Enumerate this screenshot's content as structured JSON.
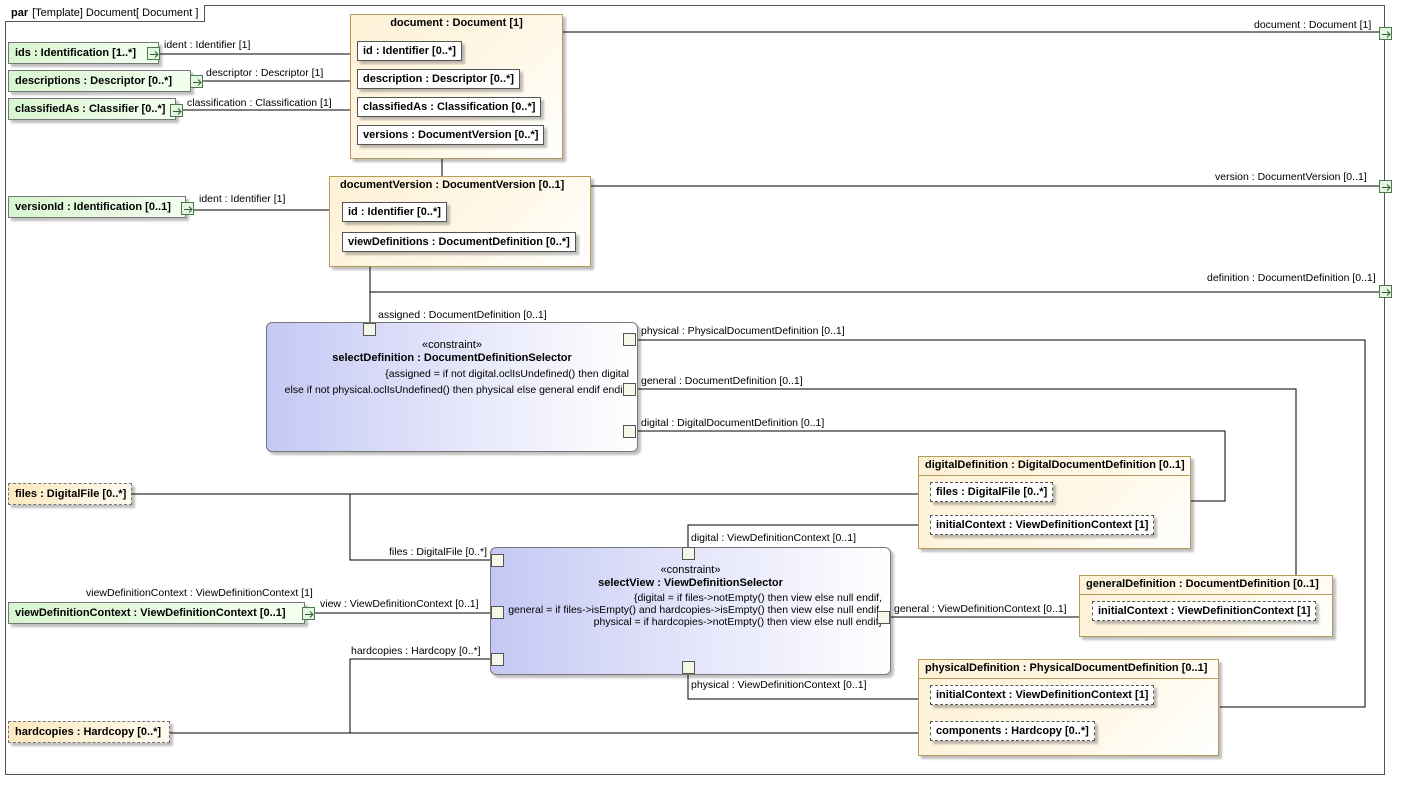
{
  "frame": {
    "kind": "par",
    "title": "[Template] Document[ Document ]"
  },
  "labels": {
    "ident_ids": "ident : Identifier [1]",
    "descriptor": "descriptor : Descriptor [1]",
    "classification": "classification : Classification [1]",
    "ident_version": "ident : Identifier [1]",
    "port_document": "document : Document [1]",
    "port_version": "version : DocumentVersion [0..1]",
    "port_definition": "definition : DocumentDefinition [0..1]",
    "assigned": "assigned : DocumentDefinition [0..1]",
    "physical_sel": "physical : PhysicalDocumentDefinition [0..1]",
    "general_sel": "general : DocumentDefinition [0..1]",
    "digital_sel": "digital : DigitalDocumentDefinition [0..1]",
    "files_port": "files : DigitalFile [0..*]",
    "vdc_ext": "viewDefinitionContext : ViewDefinitionContext [1]",
    "view_port": "view : ViewDefinitionContext [0..1]",
    "hardcopies_port": "hardcopies : Hardcopy [0..*]",
    "digital_view": "digital : ViewDefinitionContext [0..1]",
    "general_view": "general : ViewDefinitionContext [0..1]",
    "physical_view": "physical : ViewDefinitionContext [0..1]"
  },
  "externals": {
    "ids": "ids : Identification [1..*]",
    "descriptions": "descriptions : Descriptor [0..*]",
    "classifiedAs": "classifiedAs : Classifier [0..*]",
    "versionId": "versionId : Identification [0..1]",
    "files": "files : DigitalFile [0..*]",
    "viewDefinitionContext": "viewDefinitionContext : ViewDefinitionContext [0..1]",
    "hardcopies": "hardcopies : Hardcopy [0..*]"
  },
  "document": {
    "title": "document : Document [1]",
    "parts": [
      "id : Identifier [0..*]",
      "description : Descriptor [0..*]",
      "classifiedAs : Classification [0..*]",
      "versions : DocumentVersion [0..*]"
    ]
  },
  "documentVersion": {
    "title": "documentVersion : DocumentVersion [0..1]",
    "parts": [
      "id : Identifier [0..*]",
      "viewDefinitions : DocumentDefinition [0..*]"
    ]
  },
  "selectDefinition": {
    "stereotype": "«constraint»",
    "name": "selectDefinition : DocumentDefinitionSelector",
    "expr1": "{assigned = if not digital.oclIsUndefined() then digital",
    "expr2": "else if not physical.oclIsUndefined() then physical else general endif endif}"
  },
  "selectView": {
    "stereotype": "«constraint»",
    "name": "selectView : ViewDefinitionSelector",
    "expr1": "{digital = if files->notEmpty() then view else null endif,",
    "expr2": "general = if files->isEmpty() and hardcopies->isEmpty() then view else null endif,",
    "expr3": "physical = if hardcopies->notEmpty() then view else null endif}"
  },
  "digitalDefinition": {
    "title": "digitalDefinition : DigitalDocumentDefinition [0..1]",
    "parts": [
      "files : DigitalFile [0..*]",
      "initialContext : ViewDefinitionContext [1]"
    ]
  },
  "generalDefinition": {
    "title": "generalDefinition : DocumentDefinition [0..1]",
    "parts": [
      "initialContext : ViewDefinitionContext [1]"
    ]
  },
  "physicalDefinition": {
    "title": "physicalDefinition : PhysicalDocumentDefinition [0..1]",
    "parts": [
      "initialContext : ViewDefinitionContext [1]",
      "components : Hardcopy [0..*]"
    ]
  }
}
